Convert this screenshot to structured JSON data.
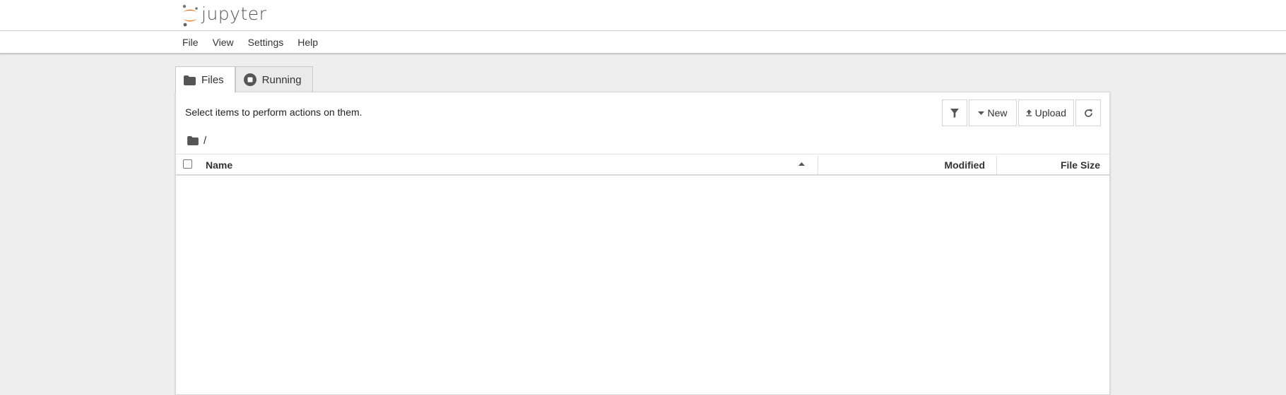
{
  "app": {
    "logo_text": "jupyter"
  },
  "menu": {
    "items": [
      "File",
      "View",
      "Settings",
      "Help"
    ]
  },
  "tabs": [
    {
      "label": "Files",
      "icon": "folder-icon",
      "active": true
    },
    {
      "label": "Running",
      "icon": "running-icon",
      "active": false
    }
  ],
  "toolbar": {
    "hint": "Select items to perform actions on them.",
    "filter_icon": "filter-icon",
    "new_label": "New",
    "upload_label": "Upload",
    "refresh_icon": "refresh-icon"
  },
  "breadcrumb": {
    "path": "/"
  },
  "file_list": {
    "columns": {
      "name": "Name",
      "modified": "Modified",
      "size": "File Size"
    },
    "sort": {
      "column": "Name",
      "direction": "ascending"
    },
    "rows": []
  },
  "colors": {
    "brand_orange": "#F37726",
    "logo_gray": "#616161",
    "icon_gray": "#555555"
  }
}
